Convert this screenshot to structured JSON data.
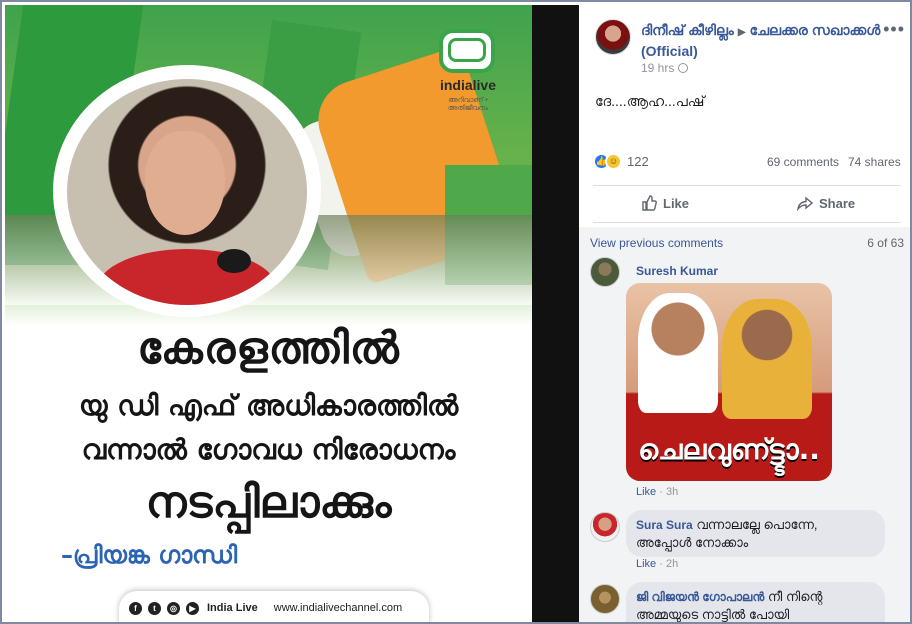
{
  "image": {
    "logo": {
      "brand": "indialive",
      "tagline": "അറിവാണ് • അതിജീവനം"
    },
    "headline_line1": "കേരളത്തിൽ",
    "headline_line2": "യു ഡി എഫ് അധികാരത്തിൽ",
    "headline_line3": "വന്നാൽ ഗോവധ നിരോധനം",
    "headline_line4": "നടപ്പിലാക്കും",
    "byline": "–പ്രിയങ്ക ഗാന്ധി",
    "footer": {
      "social_icons": [
        "facebook-icon",
        "twitter-icon",
        "instagram-icon",
        "youtube-icon"
      ],
      "brand": "India Live",
      "url": "www.indialivechannel.com"
    }
  },
  "post": {
    "page_name_part1": "ദിനീഷ് കീഴില്ലം",
    "page_name_part2": "ചേലക്കര സഖാക്കൾ (Official)",
    "time": "19 hrs",
    "more": "•••",
    "text": "ദേ....ആഹ...പഷ്",
    "reaction_count": "122",
    "comments_count": "69 comments",
    "shares_count": "74 shares",
    "like_label": "Like",
    "share_label": "Share"
  },
  "comments": {
    "view_previous": "View previous comments",
    "pager": "6 of 63",
    "items": [
      {
        "author": "Suresh Kumar",
        "image_caption": "ചെലവുണ്ട്ട്ടാ..",
        "meta_like": "Like",
        "meta_time": "3h"
      },
      {
        "author": "Sura Sura",
        "text": "വന്നാലല്ലേ പൊന്നേ, അപ്പോൾ നോക്കാം",
        "meta_like": "Like",
        "meta_time": "2h"
      },
      {
        "author": "ജി വിജയൻ ഗോപാലൻ",
        "text": "നീ നിന്റെ അമ്മയുടെ നാട്ടിൽ പോയി"
      }
    ]
  },
  "colors": {
    "fb_link": "#385898",
    "accent_green": "#3aa44a",
    "byline_blue": "#2b63b5",
    "caption_red": "#b81b17"
  }
}
